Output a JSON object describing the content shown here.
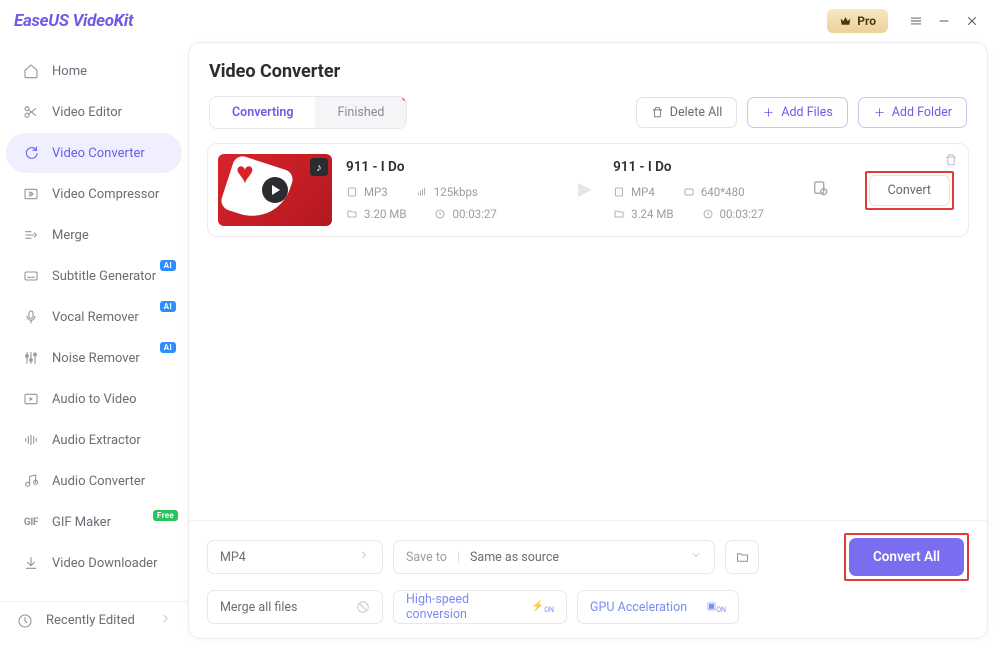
{
  "app_name": "EaseUS VideoKit",
  "pro_label": "Pro",
  "sidebar": {
    "items": [
      {
        "label": "Home"
      },
      {
        "label": "Video Editor"
      },
      {
        "label": "Video Converter"
      },
      {
        "label": "Video Compressor"
      },
      {
        "label": "Merge"
      },
      {
        "label": "Subtitle Generator"
      },
      {
        "label": "Vocal Remover"
      },
      {
        "label": "Noise Remover"
      },
      {
        "label": "Audio to Video"
      },
      {
        "label": "Audio Extractor"
      },
      {
        "label": "Audio Converter"
      },
      {
        "label": "GIF Maker"
      },
      {
        "label": "Video Downloader"
      }
    ],
    "recently_label": "Recently Edited"
  },
  "main": {
    "title": "Video Converter",
    "tabs": {
      "converting": "Converting",
      "finished": "Finished"
    },
    "buttons": {
      "delete_all": "Delete All",
      "add_files": "Add Files",
      "add_folder": "Add Folder"
    }
  },
  "item": {
    "source": {
      "name": "911 - I Do",
      "format": "MP3",
      "bitrate": "125kbps",
      "size": "3.20 MB",
      "duration": "00:03:27"
    },
    "target": {
      "name": "911 - I Do",
      "format": "MP4",
      "resolution": "640*480",
      "size": "3.24 MB",
      "duration": "00:03:27"
    },
    "convert_label": "Convert"
  },
  "footer": {
    "format": "MP4",
    "save_to_label": "Save to",
    "save_to_value": "Same as source",
    "merge_label": "Merge all files",
    "hs_label": "High-speed conversion",
    "gpu_label": "GPU Acceleration",
    "convert_all": "Convert All"
  }
}
